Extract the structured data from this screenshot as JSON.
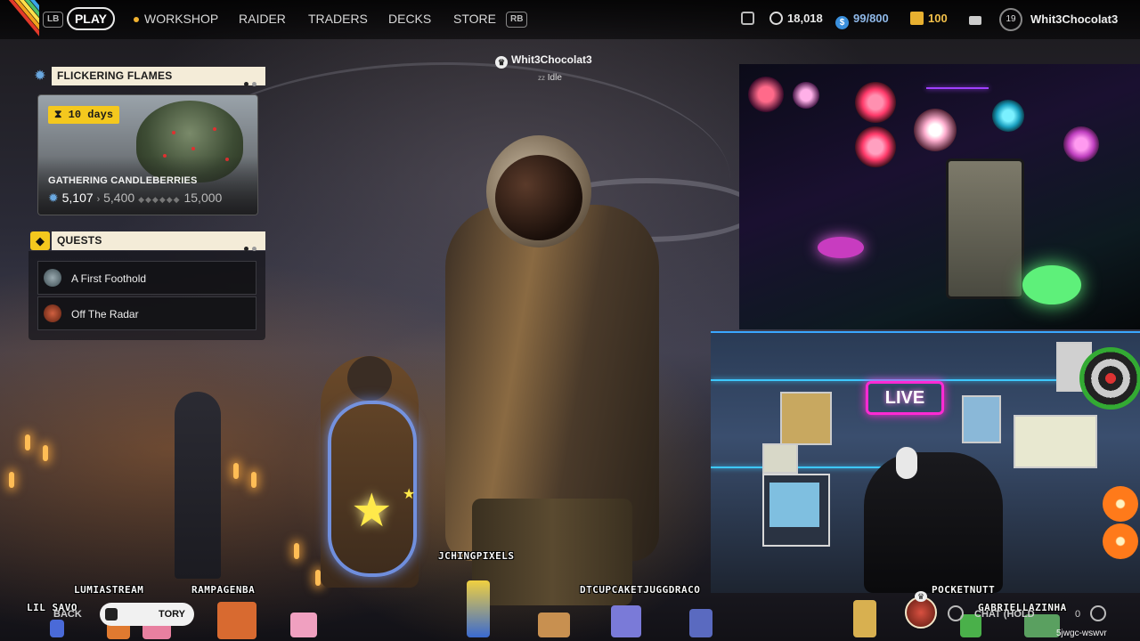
{
  "topbar": {
    "lb": "LB",
    "rb": "RB",
    "nav": [
      "PLAY",
      "WORKSHOP",
      "RAIDER",
      "TRADERS",
      "DECKS",
      "STORE"
    ],
    "stats": {
      "currency1": "18,018",
      "capacity": "99/800",
      "coins": "100"
    },
    "level": "19",
    "username": "Whit3Chocolat3"
  },
  "event": {
    "title": "FLICKERING FLAMES",
    "timer": "10 days",
    "name": "GATHERING CANDLEBERRIES",
    "progress_current": "5,107",
    "progress_next": "5,400",
    "progress_max": "15,000"
  },
  "quests": {
    "title": "QUESTS",
    "items": [
      {
        "label": "A First Foothold",
        "color": "#7a8a8a"
      },
      {
        "label": "Off The Radar",
        "color": "#b0402a"
      }
    ]
  },
  "presence": {
    "name": "Whit3Chocolat3",
    "status": "Idle"
  },
  "viewers": {
    "lil_savo": "LIL SAVO",
    "lumiastream": "LUMIASTREAM",
    "rampagenba": "RAMPAGENBA",
    "jchingpixels": "JCHINGPIXELS",
    "dtcupcake": "DTCUPCAKETJUGGDRACO",
    "pocketnutt": "POCKETNUTT",
    "gabriellazinha": "GABRIELLAZINHA"
  },
  "bottom": {
    "back": "BACK",
    "history": "TORY",
    "chat": "CHAT (HOLD",
    "chat_extra": "0",
    "code": "5jwgc-wswvr"
  },
  "cam": {
    "live_sign": "LIVE"
  },
  "colors": {
    "accent_yellow": "#f4c81e",
    "panel_head": "#f4ecd8",
    "currency_blue": "#3a8fdc",
    "coin_gold": "#e8b030"
  }
}
